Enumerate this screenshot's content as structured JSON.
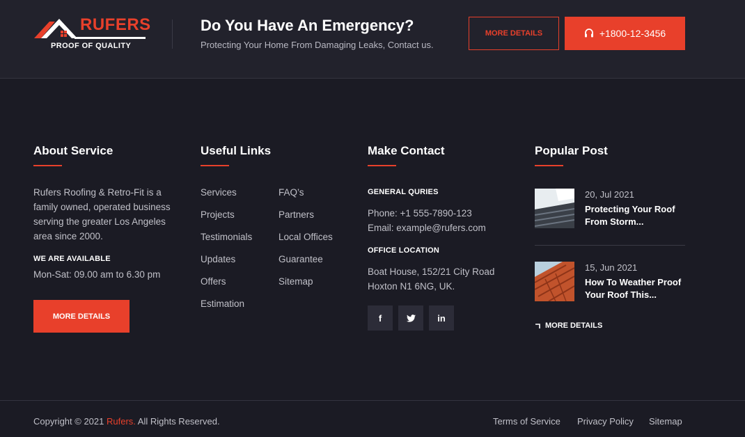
{
  "logo": {
    "name": "RUFERS",
    "tagline": "PROOF OF QUALITY"
  },
  "emergency": {
    "title": "Do You Have An Emergency?",
    "subtitle": "Protecting Your Home From Damaging Leaks, Contact us.",
    "details_label": "MORE DETAILS",
    "phone": "+1800-12-3456"
  },
  "about": {
    "title": "About Service",
    "text": "Rufers Roofing & Retro-Fit is a family owned, operated business serving the greater Los Angeles area since 2000.",
    "available_label": "WE ARE AVAILABLE",
    "hours": "Mon-Sat: 09.00 am to 6.30 pm",
    "button_label": "MORE DETAILS"
  },
  "useful_links": {
    "title": "Useful Links",
    "col1": [
      "Services",
      "Projects",
      "Testimonials",
      "Updates",
      "Offers",
      "Estimation"
    ],
    "col2": [
      "FAQ’s",
      "Partners",
      "Local Offices",
      "Guarantee",
      "Sitemap"
    ]
  },
  "contact": {
    "title": "Make Contact",
    "general_label": "GENERAL QURIES",
    "phone": "Phone: +1 555-7890-123",
    "email": "Email: example@rufers.com",
    "office_label": "OFFICE LOCATION",
    "address_line1": "Boat House, 152/21 City Road",
    "address_line2": "Hoxton N1 6NG, UK."
  },
  "social": {
    "facebook": "f",
    "twitter_icon": "twitter-icon",
    "linkedin": "in"
  },
  "popular": {
    "title": "Popular Post",
    "posts": [
      {
        "date": "20, Jul 2021",
        "title": "Protecting Your Roof From Storm..."
      },
      {
        "date": "15, Jun 2021",
        "title": "How To Weather Proof Your Roof This..."
      }
    ],
    "more_label": "MORE DETAILS"
  },
  "footer": {
    "copyright_prefix": "Copyright © 2021 ",
    "brand": "Rufers.",
    "copyright_suffix": " All Rights Reserved.",
    "links": [
      "Terms of Service",
      "Privacy Policy",
      "Sitemap"
    ]
  },
  "colors": {
    "accent": "#e8402b",
    "background": "#1b1b24",
    "topbar": "#22222c"
  }
}
